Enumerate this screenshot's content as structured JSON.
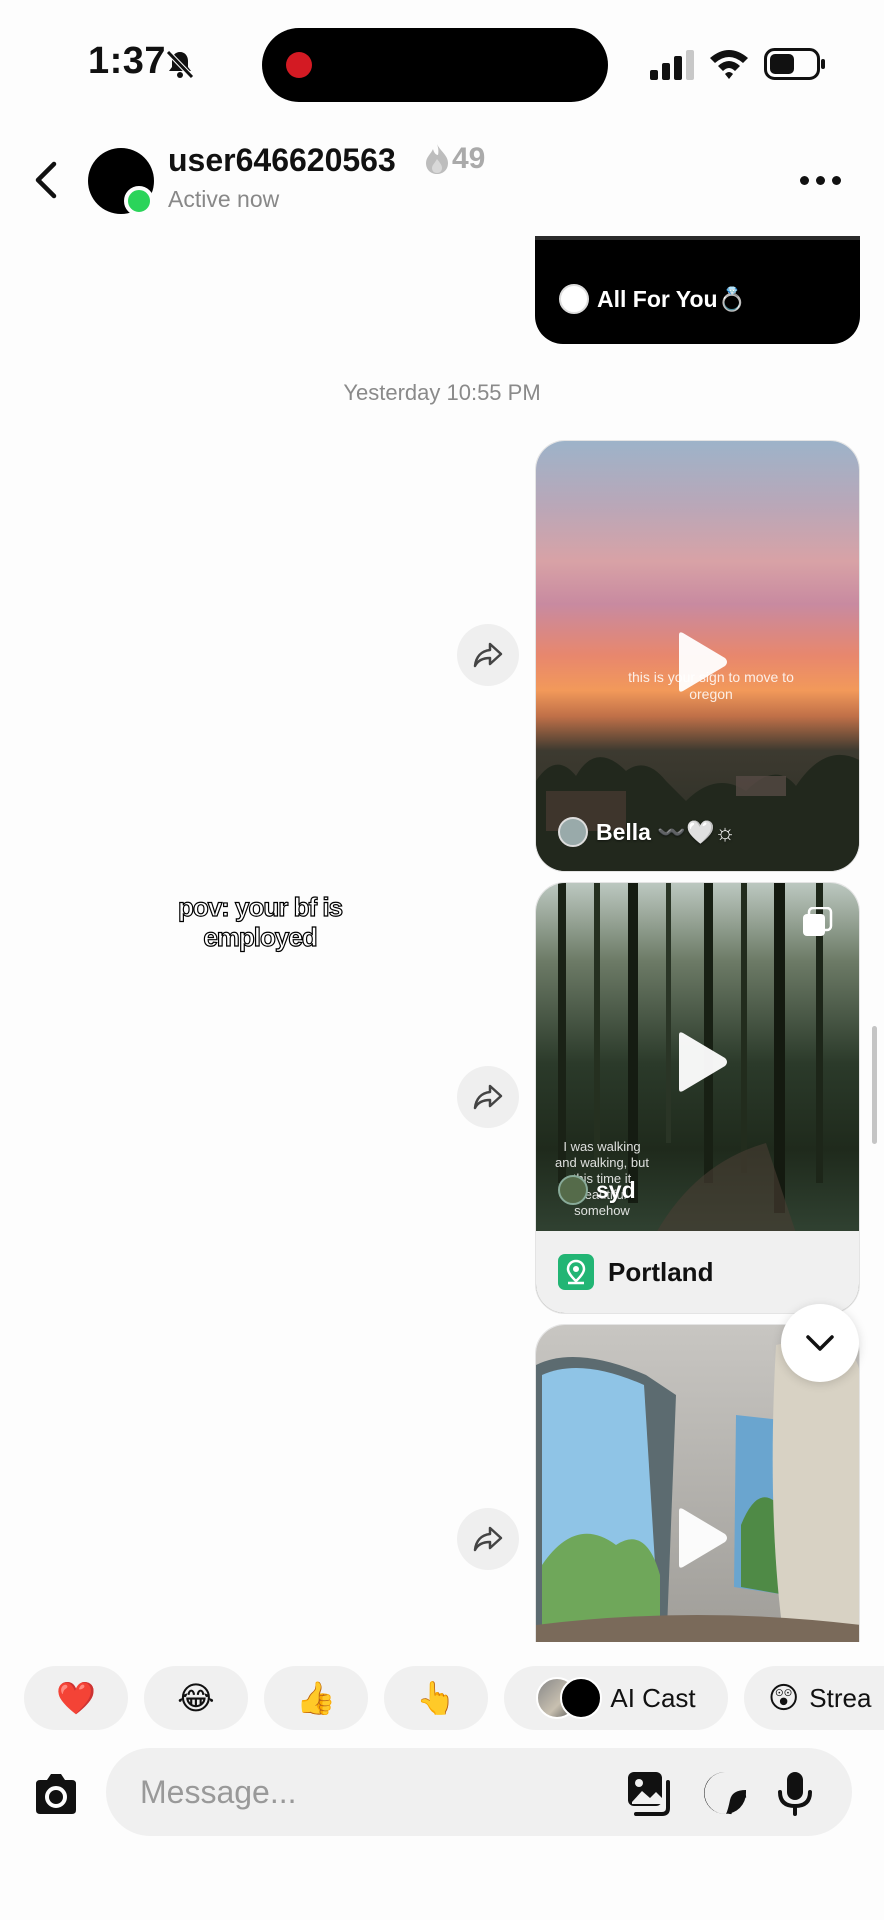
{
  "status_bar": {
    "time": "1:37",
    "icons": [
      "bell-muted-icon",
      "cellular-signal-icon",
      "wifi-icon",
      "battery-icon"
    ]
  },
  "header": {
    "username": "user646620563",
    "streak_count": "49",
    "status": "Active now",
    "online_color": "#2bd45a"
  },
  "messages": {
    "previous_card_author": "All For You💍",
    "timestamp": "Yesterday 10:55 PM",
    "video_1": {
      "caption": "this is your sign to move to oregon",
      "author": "Bella 〰️🤍☼"
    },
    "video_2": {
      "caption": "I was walking and walking, but this time it beautiful somehow",
      "author": "syd",
      "location": "Portland"
    },
    "video_3": {},
    "sticker_text": "pov: your bf is employed"
  },
  "quick_reactions": {
    "items": [
      "❤️",
      "😂",
      "👍",
      "👆"
    ],
    "ai_cast_label": "AI Cast",
    "streak_label": "Strea",
    "streak_emoji": "😲"
  },
  "composer": {
    "placeholder": "Message..."
  },
  "colors": {
    "accent_green": "#22b574",
    "background": "#fdfdfd",
    "chip": "#f0f0f0"
  }
}
